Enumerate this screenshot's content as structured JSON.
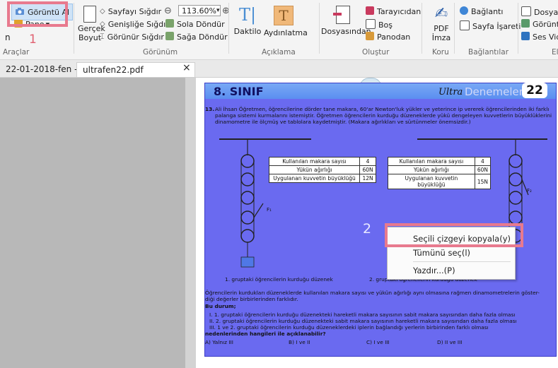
{
  "ribbon": {
    "araclar": {
      "snapshot": "Görüntü Al",
      "clipboard": "Pano",
      "group_label": "Araçlar",
      "left_cut_label": "n"
    },
    "gorunum": {
      "actual_size": "Gerçek\nBoyut",
      "fit_page": "Sayfayı Sığdır",
      "fit_width": "Genişliğe Sığdır",
      "fit_visible": "Görünür Sığdır",
      "zoom_value": "113.60%",
      "rotate_left": "Sola Döndür",
      "rotate_right": "Sağa Döndür",
      "group_label": "Görünüm"
    },
    "aciklama": {
      "typewriter": "Daktilo",
      "highlight": "Aydınlatma",
      "group_label": "Açıklama"
    },
    "olustur": {
      "from_file": "Dosyasından",
      "from_scanner": "Tarayıcıdan",
      "blank": "Boş",
      "from_clipboard": "Panodan",
      "group_label": "Oluştur"
    },
    "koru": {
      "pdf_sign": "PDF\nİmza",
      "group_label": "Koru"
    },
    "baglantilar": {
      "link": "Bağlantı",
      "bookmark": "Sayfa İşareti",
      "group_label": "Bağlantılar"
    },
    "ekle": {
      "file": "Dosya E",
      "image": "Görüntü",
      "audio": "Ses Vid",
      "group_label": "El"
    }
  },
  "tabs": [
    {
      "label": "22-01-2018-fen -..."
    },
    {
      "label": "ultrafen22.pdf"
    }
  ],
  "tab_close": "×",
  "annotations": {
    "step1": "1",
    "step2": "2"
  },
  "document": {
    "grade": "8. SINIF",
    "brand_ultra": "Ultra",
    "brand_rest": "Denemeler",
    "page_number": "22",
    "question_number": "13.",
    "question_lines": [
      "Ali İhsan Öğretmen, öğrencilerine dörder tane makara, 60'ar Newton'luk yükler ve yeterince ip vererek öğrencilerinden iki farklı",
      "palanga sistemi kurmalarını istemiştir. Öğretmen öğrencilerin kurduğu düzeneklerde yükü dengeleyen kuvvetlerin büyüklüklerini",
      "dinamometre ile ölçmüş ve tablolara kaydetmiştir. (Makara ağırlıkları ve sürtünmeler önemsizdir.)"
    ],
    "table1": [
      [
        "Kullanılan makara sayısı",
        "4"
      ],
      [
        "Yükün ağırlığı",
        "60N"
      ],
      [
        "Uygulanan kuvvetin büyüklüğü",
        "12N"
      ]
    ],
    "table2": [
      [
        "Kullanılan makara sayısı",
        "4"
      ],
      [
        "Yükün ağırlığı",
        "60N"
      ],
      [
        "Uygulanan kuvvetin büyüklüğü",
        "15N"
      ]
    ],
    "force1": "F₁",
    "force2": "F₂",
    "caption1": "1. gruptaki öğrencilerin kurduğu düzenek",
    "caption2": "2. gruptaki öğrencilerin kurduğu düzenek",
    "body_lines": [
      "Öğrencilerin kurdukları düzeneklerde kullanılan makara sayısı ve yükün ağırlığı aynı olmasına rağmen dinamometrelerin göster-",
      "diği değerler birbirlerinden farklıdır."
    ],
    "bu_durum": "Bu durum;",
    "options_lines": [
      "I. 1. gruptaki öğrencilerin kurduğu düzenekteki hareketli makara sayısının sabit makara sayısından daha fazla olması",
      "II. 2. gruptaki öğrencilerin kurduğu düzenekteki sabit makara sayısının hareketli makara sayısından daha fazla olması",
      "III. 1 ve 2. gruptaki öğrencilerin kurduğu düzeneklerdeki iplerin bağlandığı yerlerin birbirinden farklı olması"
    ],
    "question_end": "nedenlerinden hangileri ile açıklanabilir?",
    "answers": [
      "A)  Yalnız  III",
      "B)  I ve  II",
      "C)  I ve III",
      "D)  II ve III"
    ]
  },
  "context_menu": {
    "items": [
      "Seçili çizgeyi kopyala(y)",
      "Tümünü seç(l)",
      "Yazdır...(P)"
    ]
  },
  "colors": {
    "highlight_box": "#e87a8e",
    "selection": "#6a6af0",
    "header_blue": "#1f8fd8"
  }
}
